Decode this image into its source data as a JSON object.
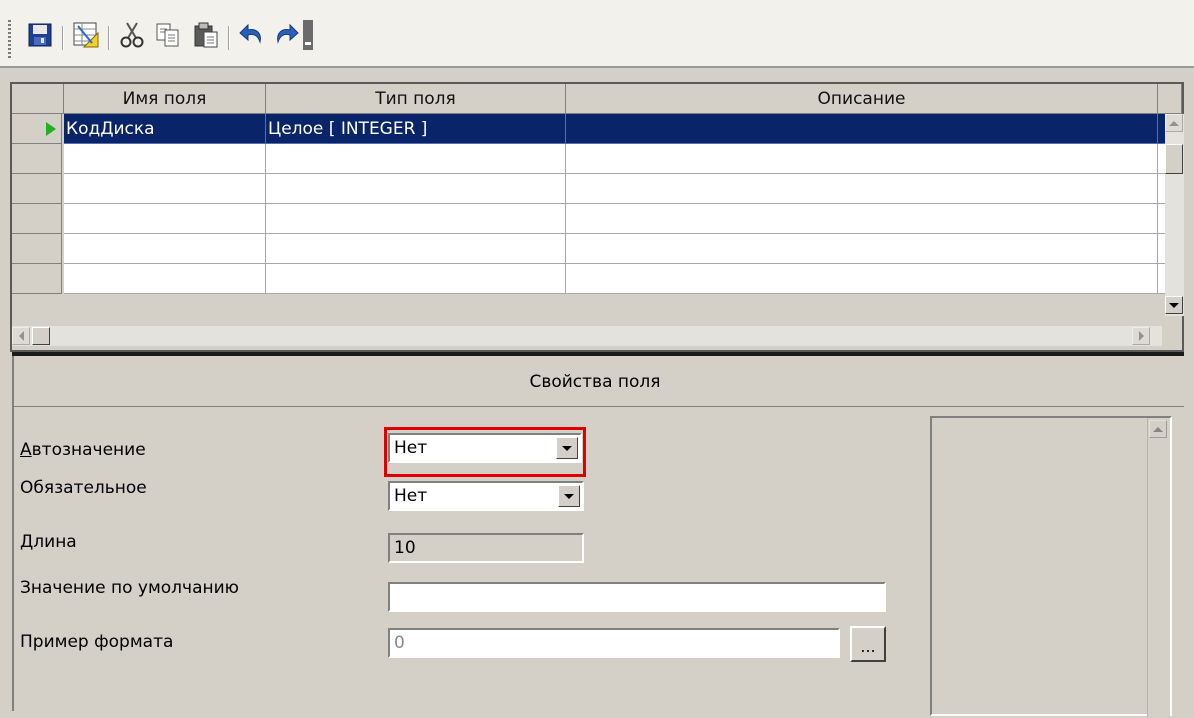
{
  "toolbar": {
    "buttons": [
      {
        "icon": "save-icon"
      },
      {
        "icon": "table-design-icon"
      },
      {
        "icon": "cut-icon"
      },
      {
        "icon": "copy-icon"
      },
      {
        "icon": "paste-icon"
      },
      {
        "icon": "undo-icon"
      },
      {
        "icon": "redo-icon"
      },
      {
        "icon": "toolbar-options-icon"
      }
    ]
  },
  "grid": {
    "columns": [
      "Имя поля",
      "Тип поля",
      "Описание"
    ],
    "rows": [
      {
        "name": "КодДиска",
        "type": "Целое [ INTEGER ]",
        "description": "",
        "selected": true
      },
      {
        "name": "",
        "type": "",
        "description": ""
      },
      {
        "name": "",
        "type": "",
        "description": ""
      },
      {
        "name": "",
        "type": "",
        "description": ""
      },
      {
        "name": "",
        "type": "",
        "description": ""
      },
      {
        "name": "",
        "type": "",
        "description": ""
      }
    ]
  },
  "properties": {
    "title": "Свойства поля",
    "auto_value": {
      "label": "Автозначение",
      "accesskey": "А",
      "value": "Нет"
    },
    "required": {
      "label": "Обязательное",
      "value": "Нет"
    },
    "length": {
      "label": "Длина",
      "value": "10"
    },
    "default_value": {
      "label": "Значение по умолчанию",
      "value": ""
    },
    "format_example": {
      "label": "Пример формата",
      "value": "0",
      "button_label": "..."
    }
  },
  "colors": {
    "selection": "#0a246a",
    "highlight": "#e00000",
    "row_indicator": "#22b020"
  }
}
